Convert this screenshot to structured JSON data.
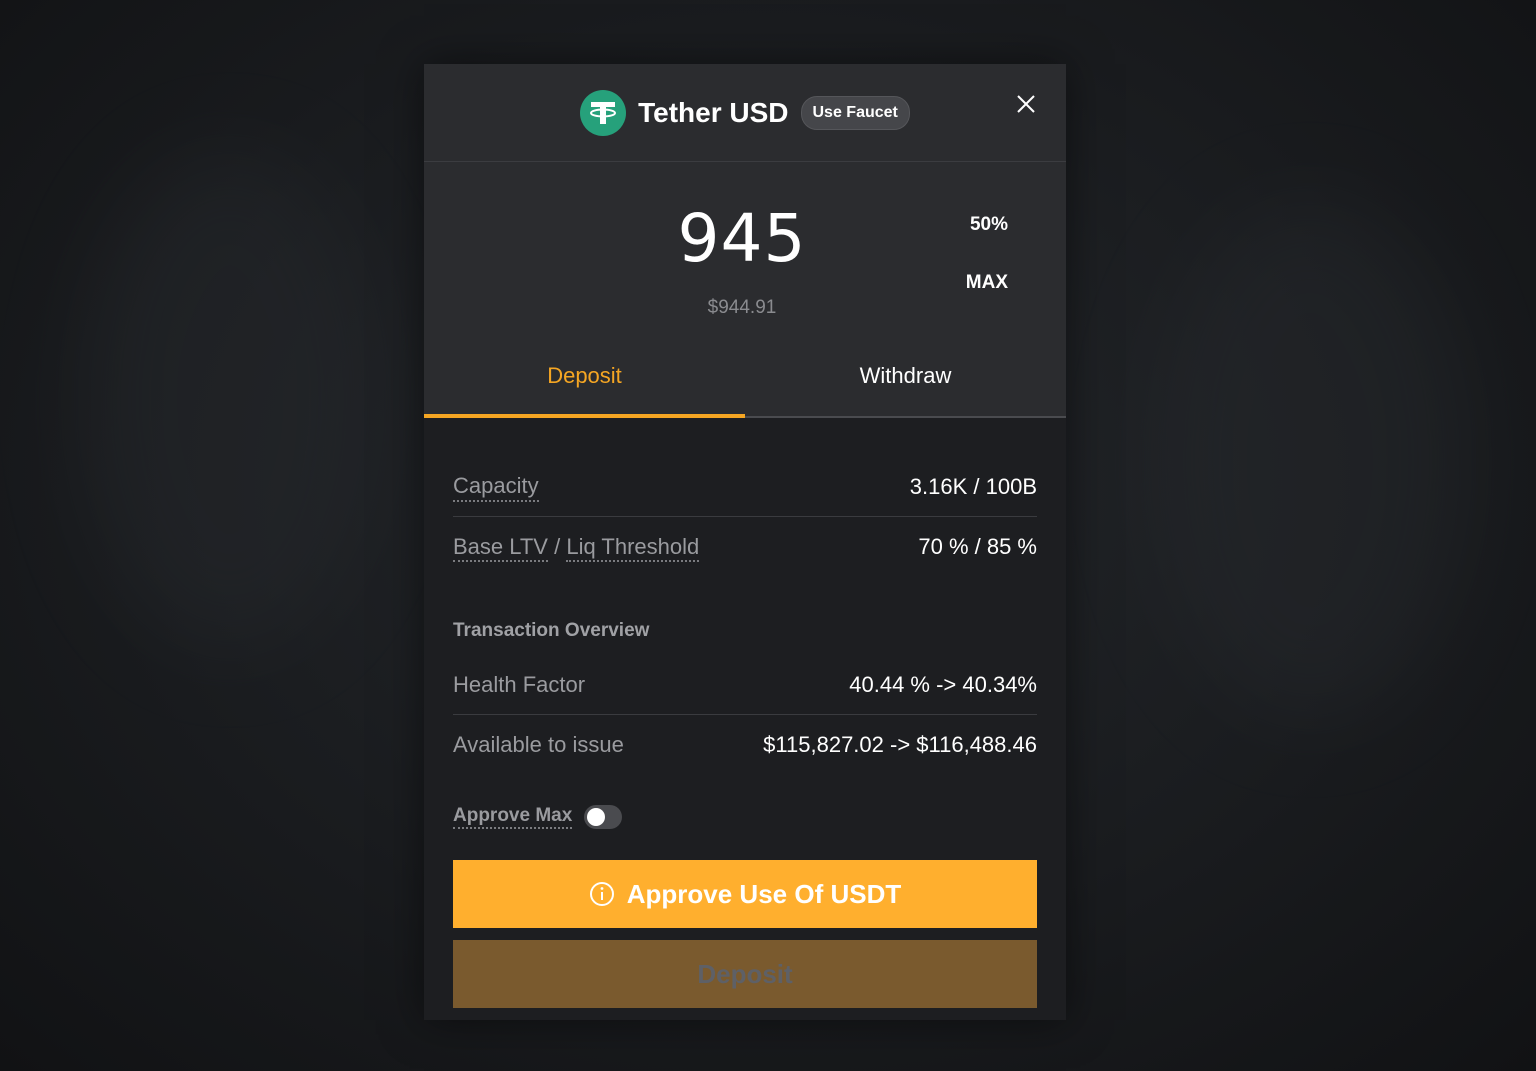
{
  "header": {
    "token_name": "Tether USD",
    "faucet_label": "Use Faucet",
    "token_color": "#26a17b"
  },
  "amount": {
    "value": "945",
    "usd_value": "$944.91",
    "half_label": "50%",
    "max_label": "MAX"
  },
  "tabs": [
    {
      "label": "Deposit",
      "active": true
    },
    {
      "label": "Withdraw",
      "active": false
    }
  ],
  "stats": {
    "capacity_label": "Capacity",
    "capacity_value": "3.16K / 100B",
    "ltv_label": "Base LTV",
    "ltv_sep": " / ",
    "liq_label": "Liq Threshold",
    "ltv_value": "70 % / 85 %"
  },
  "overview": {
    "title": "Transaction Overview",
    "health_label": "Health Factor",
    "health_value": "40.44 % -> 40.34%",
    "available_label": "Available to issue",
    "available_value": "$115,827.02 -> $116,488.46"
  },
  "approve_max": {
    "label": "Approve Max",
    "enabled": false
  },
  "actions": {
    "approve_label": "Approve Use Of USDT",
    "deposit_label": "Deposit"
  },
  "colors": {
    "accent": "#f5a623",
    "approve_button": "#ffaf2e",
    "deposit_button_disabled": "#7a5a2e"
  }
}
